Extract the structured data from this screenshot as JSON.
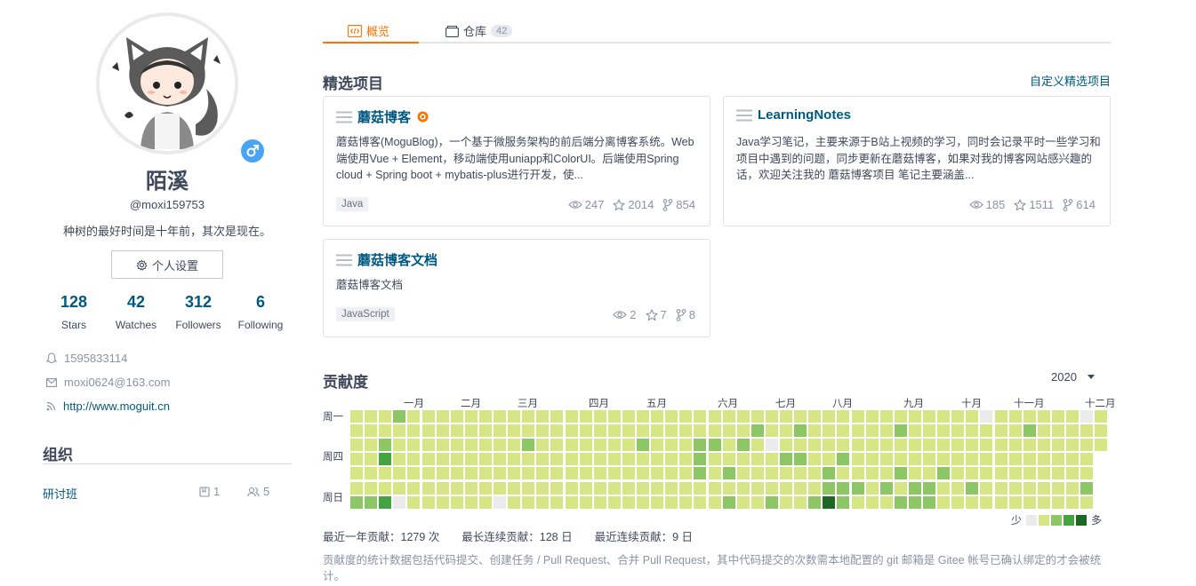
{
  "profile": {
    "name": "陌溪",
    "username": "@moxi159753",
    "bio": "种树的最好时间是十年前，其次是现在。",
    "settings_label": "个人设置",
    "stats": [
      {
        "value": "128",
        "label": "Stars"
      },
      {
        "value": "42",
        "label": "Watches"
      },
      {
        "value": "312",
        "label": "Followers"
      },
      {
        "value": "6",
        "label": "Following"
      }
    ],
    "qq": "1595833114",
    "email": "moxi0624@163.com",
    "website": "http://www.moguit.cn",
    "gender_icon": "male-icon"
  },
  "org": {
    "title": "组织",
    "items": [
      {
        "name": "研讨班",
        "repos": "1",
        "members": "5"
      }
    ]
  },
  "tabs": [
    {
      "label": "概览",
      "icon": "code-icon",
      "active": true
    },
    {
      "label": "仓库",
      "icon": "repo-icon",
      "count": "42"
    }
  ],
  "featured": {
    "title": "精选项目",
    "customize_label": "自定义精选项目",
    "projects": [
      {
        "name": "蘑菇博客",
        "badge": "gvp-badge-icon",
        "desc": "蘑菇博客(MoguBlog)，一个基于微服务架构的前后端分离博客系统。Web端使用Vue + Element，移动端使用uniapp和ColorUI。后端使用Spring cloud + Spring boot + mybatis-plus进行开发，使...",
        "lang": "Java",
        "watch": "247",
        "star": "2014",
        "fork": "854"
      },
      {
        "name": "LearningNotes",
        "desc": "Java学习笔记，主要来源于B站上视频的学习，同时会记录平时一些学习和项目中遇到的问题，同步更新在蘑菇博客，如果对我的博客网站感兴趣的话，欢迎关注我的 蘑菇博客项目 笔记主要涵盖...",
        "lang": "",
        "watch": "185",
        "star": "1511",
        "fork": "614"
      },
      {
        "name": "蘑菇博客文档",
        "desc": "蘑菇博客文档",
        "lang": "JavaScript",
        "watch": "2",
        "star": "7",
        "fork": "8"
      }
    ]
  },
  "contribution": {
    "title": "贡献度",
    "year": "2020",
    "months": [
      "一月",
      "二月",
      "三月",
      "四月",
      "五月",
      "六月",
      "七月",
      "八月",
      "九月",
      "十月",
      "十一月",
      "十二月"
    ],
    "days": [
      "周一",
      "周四",
      "周日"
    ],
    "legend_less": "少",
    "legend_more": "多",
    "colors": [
      "#ebebeb",
      "#d6e685",
      "#8cc665",
      "#44a340",
      "#1e6823"
    ],
    "summary": [
      "最近一年贡献：1279 次",
      "最长连续贡献：128 日",
      "最近连续贡献：9 日"
    ],
    "note": "贡献度的统计数据包括代码提交、创建任务 / Pull Request、合并 Pull Request，其中代码提交的次数需本地配置的 git 邮箱是 Gitee 帐号已确认绑定的才会被统计。"
  }
}
